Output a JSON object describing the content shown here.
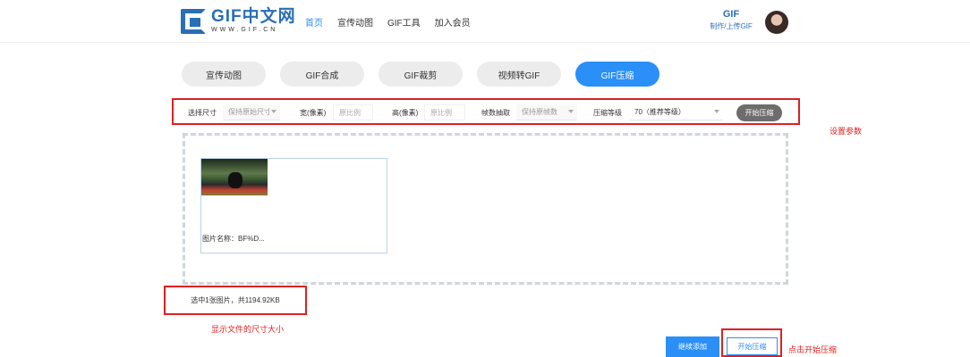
{
  "header": {
    "logo_title": "GIF中文网",
    "logo_sub": "WWW.GIF.CN",
    "nav": [
      "首页",
      "宣传动图",
      "GIF工具",
      "加入会员"
    ],
    "user_gif_title": "GIF",
    "user_gif_sub": "制作/上传GIF"
  },
  "tabs": [
    "宣传动图",
    "GIF合成",
    "GIF裁剪",
    "视频转GIF",
    "GIF压缩"
  ],
  "settings": {
    "size_label": "选择尺寸",
    "size_value": "保持原始尺寸",
    "width_label": "宽(像素)",
    "width_placeholder": "原比例",
    "height_label": "高(像素)",
    "height_placeholder": "原比例",
    "frame_label": "帧数抽取",
    "frame_value": "保持原帧数",
    "level_label": "压缩等级",
    "level_value": "70（推荐等级）",
    "start_label": "开始压缩"
  },
  "annotations": {
    "params": "设置参数",
    "size": "显示文件的尺寸大小",
    "start": "点击开始压缩"
  },
  "file": {
    "name_label": "图片名称：BF%D..."
  },
  "summary": "选中1张图片，共1194.92KB",
  "buttons": {
    "continue": "继续添加",
    "start": "开始压缩"
  },
  "colors": {
    "accent": "#2a8ff7",
    "annotation": "#e02020",
    "brand": "#2a6fb5"
  }
}
